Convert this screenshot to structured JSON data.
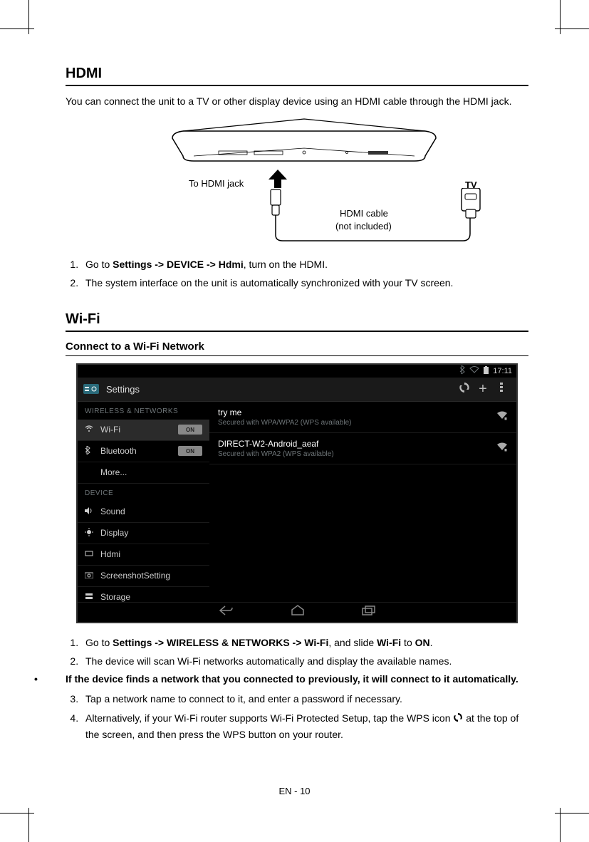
{
  "hdmi": {
    "heading": "HDMI",
    "intro": "You can connect the unit to a TV or other display device using an HDMI cable through the HDMI jack.",
    "labels": {
      "toJack": "To HDMI jack",
      "tv": "TV",
      "cable1": "HDMI cable",
      "cable2": "(not included)"
    },
    "steps": [
      {
        "pre": "Go to ",
        "bold": "Settings -> DEVICE -> Hdmi",
        "post": ", turn on the HDMI."
      },
      {
        "text": "The system interface on the unit is automatically synchronized with your TV screen."
      }
    ]
  },
  "wifi": {
    "heading": "Wi-Fi",
    "subheading": "Connect to a Wi-Fi Network",
    "screenshot": {
      "statusTime": "17:11",
      "actionbarTitle": "Settings",
      "catWireless": "WIRELESS & NETWORKS",
      "catDevice": "DEVICE",
      "leftItems": {
        "wifi": "Wi-Fi",
        "bluetooth": "Bluetooth",
        "more": "More...",
        "sound": "Sound",
        "display": "Display",
        "hdmi": "Hdmi",
        "screenshot": "ScreenshotSetting",
        "storage": "Storage"
      },
      "toggleOn": "ON",
      "networks": [
        {
          "name": "try me",
          "sub": "Secured with WPA/WPA2 (WPS available)"
        },
        {
          "name": "DIRECT-W2-Android_aeaf",
          "sub": "Secured with WPA2 (WPS available)"
        }
      ]
    },
    "step1_pre": "Go to ",
    "step1_b1": "Settings -> WIRELESS & NETWORKS -> Wi-Fi",
    "step1_mid": ", and slide ",
    "step1_b2": "Wi-Fi",
    "step1_mid2": " to ",
    "step1_b3": "ON",
    "step1_post": ".",
    "step2": "The device will scan Wi-Fi networks automatically and display the available names.",
    "bullet": "If the device finds a network that you connected to previously, it will connect to it automatically.",
    "step3": "Tap a network name to connect to it, and enter a password if necessary.",
    "step4a": "Alternatively, if your Wi-Fi router supports Wi-Fi Protected Setup, tap the WPS icon ",
    "step4b": "at the top of the screen, and then press the WPS button on your router."
  },
  "pageNumber": "EN - 10"
}
